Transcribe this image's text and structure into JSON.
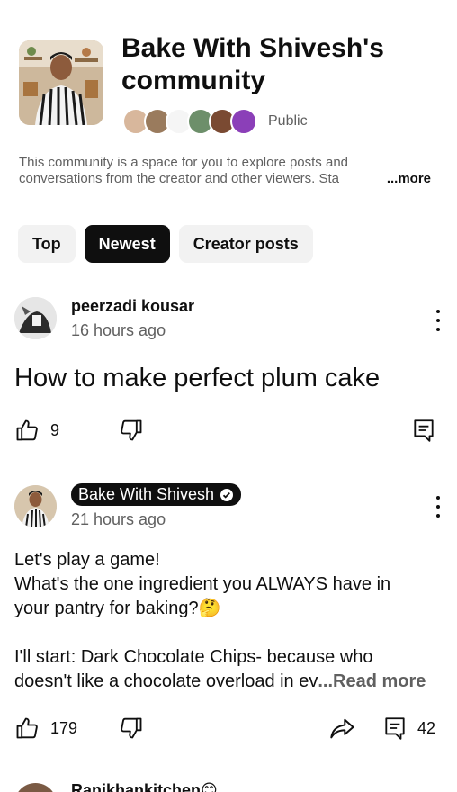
{
  "community": {
    "title_line1": "Bake With Shivesh's",
    "title_line2": "community",
    "visibility": "Public",
    "description": "This community is a space for you to explore posts and conversations from the creator and other viewers. Sta",
    "more_label": "...more"
  },
  "filters": [
    {
      "label": "Top",
      "selected": false
    },
    {
      "label": "Newest",
      "selected": true
    },
    {
      "label": "Creator posts",
      "selected": false
    }
  ],
  "posts": [
    {
      "author": "peerzadi kousar",
      "time": "16 hours ago",
      "title": "How to make perfect plum cake",
      "likes": "9"
    },
    {
      "author": "Bake With Shivesh",
      "time": "21 hours ago",
      "text_line1": "Let's play a game!",
      "text_line2": "What's the one ingredient you ALWAYS have in",
      "text_line3": "your pantry for baking?🤔",
      "text_line4": "I'll start: Dark Chocolate Chips- because who",
      "text_line5": "doesn't like a chocolate overload in ev",
      "read_more": "...Read more",
      "likes": "179",
      "comments": "42"
    },
    {
      "author": "Ranikhankitchen😊"
    }
  ],
  "colors": {
    "text": "#0f0f0f",
    "secondary": "#606060",
    "chip_bg": "#f2f2f2",
    "chip_active_bg": "#0f0f0f"
  }
}
